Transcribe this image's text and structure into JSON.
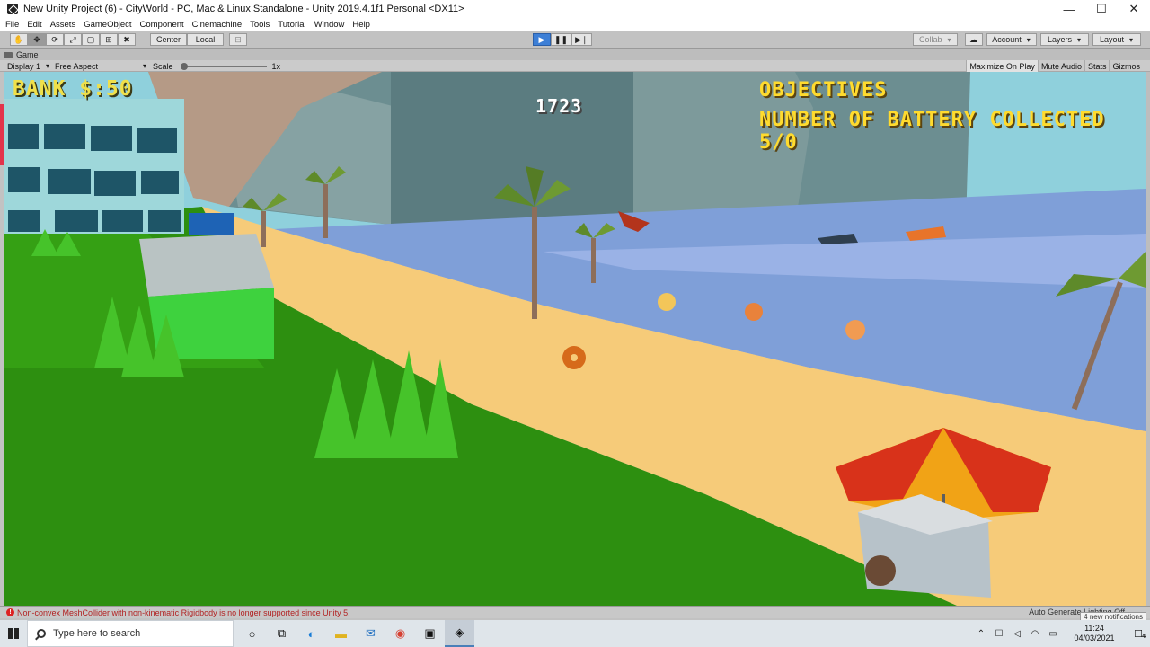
{
  "window": {
    "title": "New Unity Project (6) - CityWorld - PC, Mac & Linux Standalone - Unity 2019.4.1f1 Personal <DX11>",
    "minimize": "—",
    "maximize": "☐",
    "close": "✕"
  },
  "menu": [
    "File",
    "Edit",
    "Assets",
    "GameObject",
    "Component",
    "Cinemachine",
    "Tools",
    "Tutorial",
    "Window",
    "Help"
  ],
  "toolbar": {
    "tools": [
      "✋",
      "✥",
      "⟳",
      "⤢",
      "▢",
      "⊞",
      "✖"
    ],
    "pivot_label": "Center",
    "space_label": "Local",
    "snap_icon": "⊟",
    "play": "▶",
    "pause": "❚❚",
    "step": "▶❘",
    "collab_label": "Collab",
    "cloud_icon": "☁",
    "account_label": "Account",
    "layers_label": "Layers",
    "layout_label": "Layout"
  },
  "tab": {
    "title": "Game",
    "menu": "⋮"
  },
  "gamebar": {
    "display": "Display 1",
    "aspect": "Free Aspect",
    "scale_label": "Scale",
    "scale_value": "1x",
    "maximize": "Maximize On Play",
    "mute": "Mute Audio",
    "stats": "Stats",
    "gizmos": "Gizmos"
  },
  "hud": {
    "bank": "BANK $:50",
    "counter": "1723",
    "objectives_title": "OBJECTIVES",
    "objectives_line": "NUMBER OF BATTERY COLLECTED 5/0"
  },
  "status": {
    "message": "Non-convex MeshCollider with non-kinematic Rigidbody is no longer supported since Unity 5.",
    "right": "Auto Generate Lighting Off",
    "tooltip": "4 new notifications"
  },
  "taskbar": {
    "search_placeholder": "Type here to search",
    "time": "11:24",
    "date": "04/03/2021",
    "notif_count": "4"
  },
  "colors": {
    "accent": "#3d7fd6",
    "error": "#b22222",
    "hud_yellow": "#ffdb2e"
  }
}
